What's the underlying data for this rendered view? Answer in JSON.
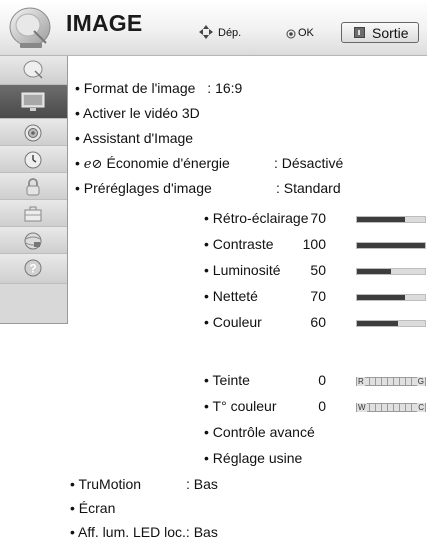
{
  "header": {
    "title": "IMAGE",
    "nav_hint": "Dép.",
    "ok_label": "OK",
    "exit_label": "Sortie",
    "icon": "satellite-dish-icon"
  },
  "sidebar": {
    "items": [
      {
        "icon": "satellite-dish-icon",
        "active": false
      },
      {
        "icon": "tv-screen-icon",
        "active": true
      },
      {
        "icon": "speaker-icon",
        "active": false
      },
      {
        "icon": "clock-icon",
        "active": false
      },
      {
        "icon": "lock-icon",
        "active": false
      },
      {
        "icon": "suitcase-icon",
        "active": false
      },
      {
        "icon": "globe-usb-icon",
        "active": false
      },
      {
        "icon": "help-icon",
        "active": false
      }
    ]
  },
  "menu": {
    "format": {
      "label": "Format de l'image",
      "value": ": 16:9"
    },
    "video3d": {
      "label": "Activer le vidéo 3D"
    },
    "assistant": {
      "label": "Assistant d'Image"
    },
    "energy": {
      "label": "Économie d'énergie",
      "value": ": Désactivé",
      "icon": "eco-icon"
    },
    "presets": {
      "label": "Préréglages d'image",
      "value": ": Standard"
    },
    "settings": [
      {
        "label": "Rétro-éclairage",
        "value": "70",
        "level": 0.7
      },
      {
        "label": "Contraste",
        "value": "100",
        "level": 1.0
      },
      {
        "label": "Luminosité",
        "value": "50",
        "level": 0.5
      },
      {
        "label": "Netteté",
        "value": "70",
        "level": 0.7
      },
      {
        "label": "Couleur",
        "value": "60",
        "level": 0.6
      }
    ],
    "tint": {
      "label": "Teinte",
      "value": "0",
      "left": "R",
      "right": "G"
    },
    "colortemp": {
      "label": "T° couleur",
      "value": "0",
      "left": "W",
      "right": "C"
    },
    "advanced": {
      "label": "Contrôle avancé"
    },
    "reset": {
      "label": "Réglage usine"
    },
    "trumotion": {
      "label": "TruMotion",
      "value": ": Bas"
    },
    "screen": {
      "label": "Écran"
    },
    "led": {
      "label": "Aff. lum. LED loc.: Bas"
    }
  }
}
